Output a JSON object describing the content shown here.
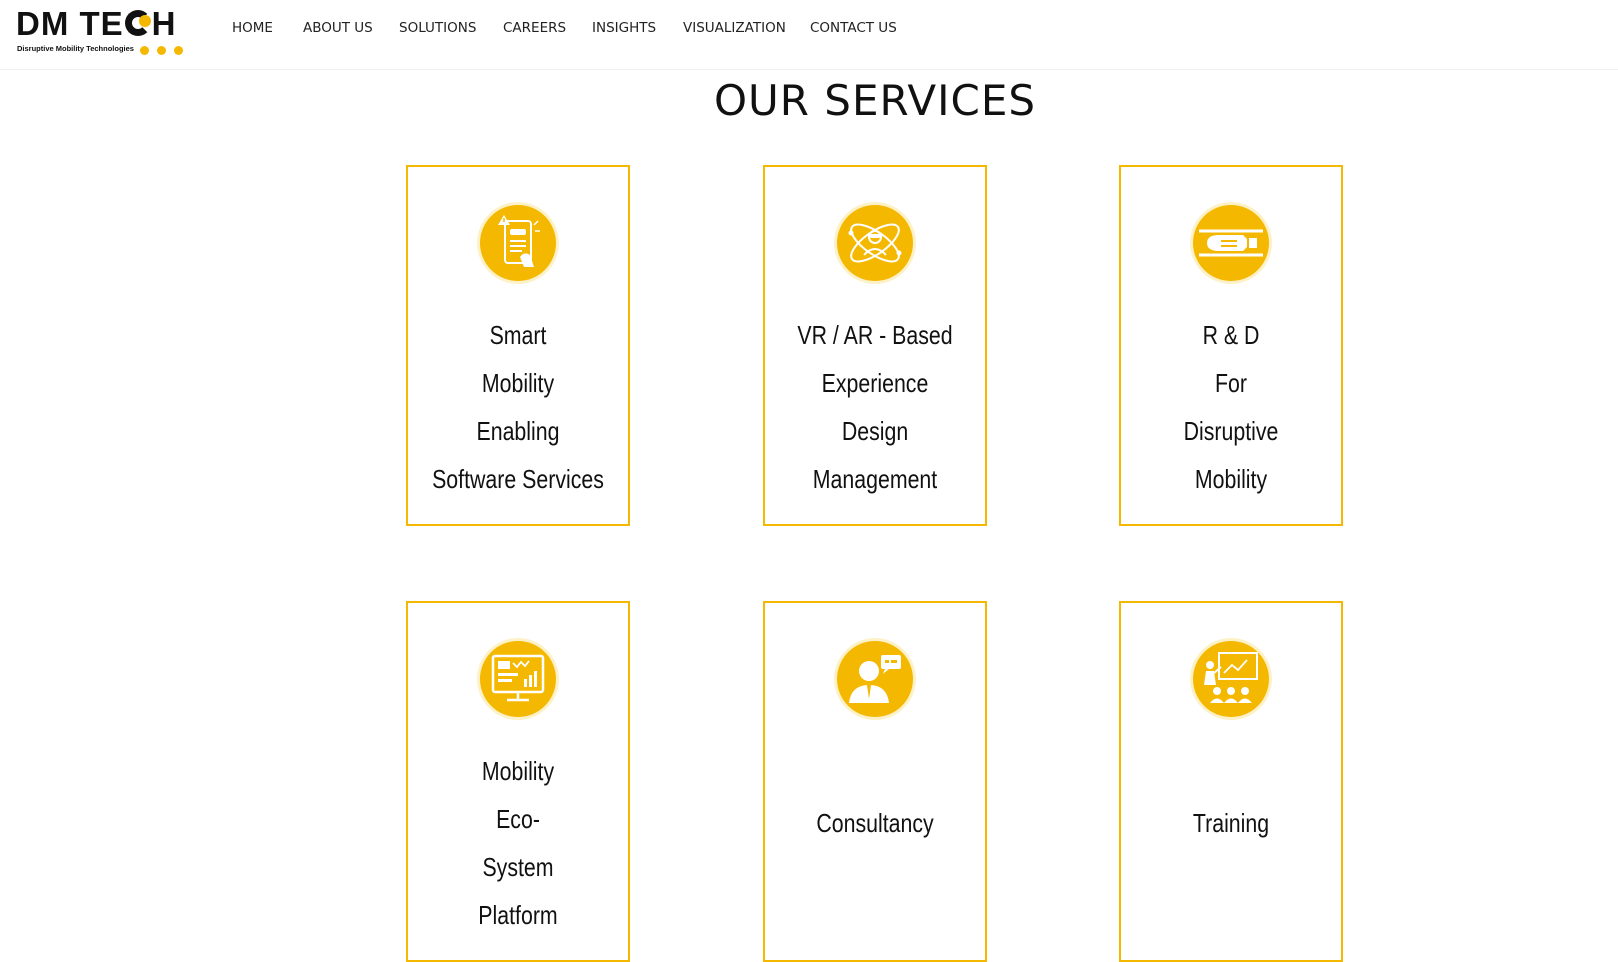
{
  "header": {
    "logo": {
      "text_before": "DM TE",
      "text_after": "H",
      "tagline": "Disruptive Mobility Technologies",
      "brand_color": "#f5b800"
    },
    "nav": [
      {
        "label": "HOME"
      },
      {
        "label": "ABOUT US"
      },
      {
        "label": "SOLUTIONS"
      },
      {
        "label": "CAREERS"
      },
      {
        "label": "INSIGHTS"
      },
      {
        "label": "VISUALIZATION"
      },
      {
        "label": "CONTACT US"
      }
    ]
  },
  "main": {
    "title": "OUR SERVICES",
    "accent_color": "#f5b800",
    "services": [
      {
        "icon": "smart-mobility-phone-icon",
        "lines": [
          "Smart",
          "Mobility",
          "Enabling",
          "Software Services"
        ]
      },
      {
        "icon": "vr-ar-atom-person-icon",
        "lines": [
          "VR / AR - Based",
          "Experience",
          "Design",
          "Management"
        ]
      },
      {
        "icon": "hyperloop-pod-icon",
        "lines": [
          "R & D",
          "For",
          "Disruptive",
          "Mobility"
        ]
      },
      {
        "icon": "dashboard-monitor-icon",
        "lines": [
          "Mobility",
          "Eco-",
          "System",
          "Platform"
        ]
      },
      {
        "icon": "consultant-person-icon",
        "lines": [
          "Consultancy"
        ]
      },
      {
        "icon": "training-presentation-icon",
        "lines": [
          "Training"
        ]
      }
    ]
  }
}
